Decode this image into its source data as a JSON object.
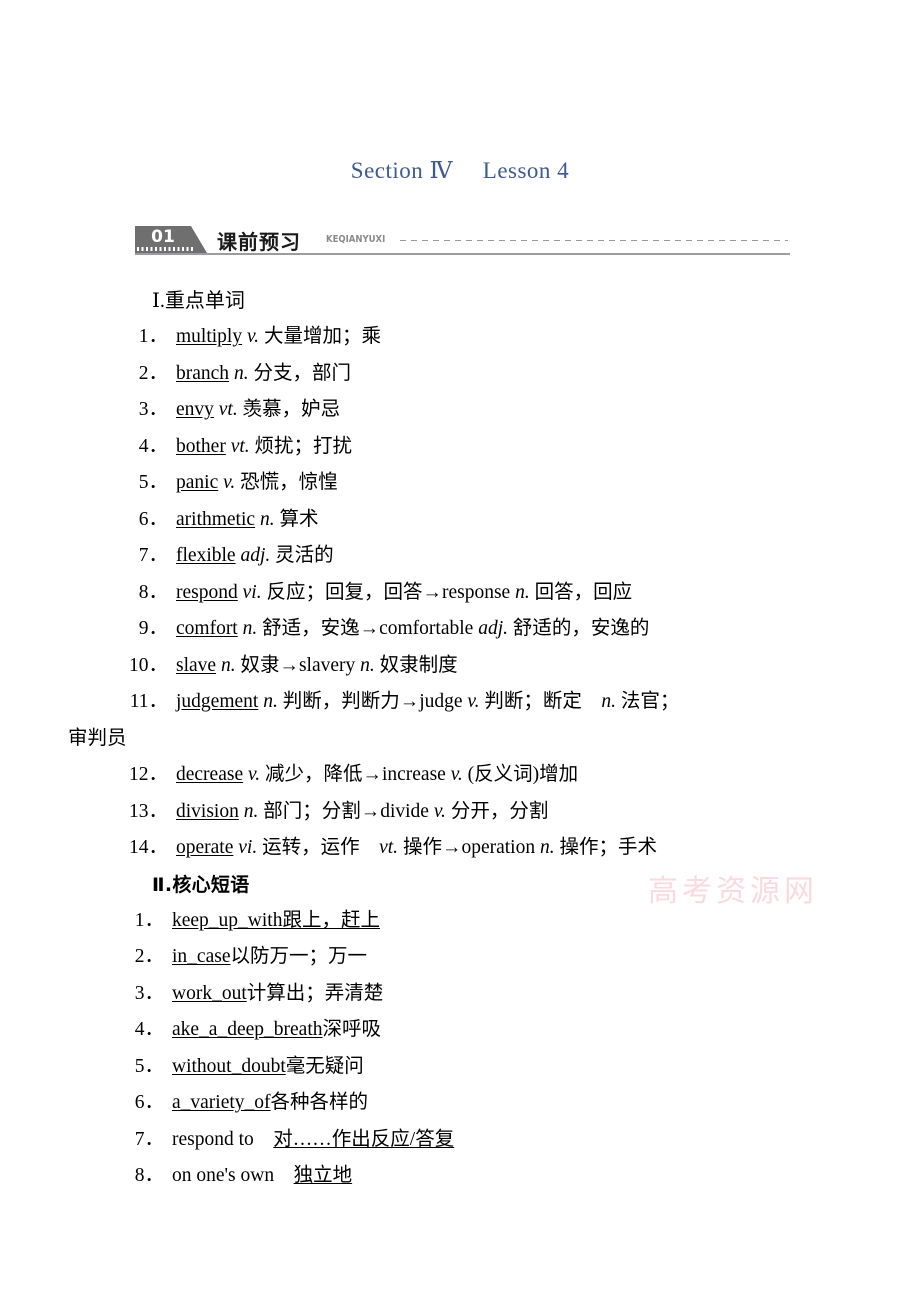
{
  "title": "Section Ⅳ  Lesson 4",
  "banner": {
    "number": "01",
    "label": "课前预习",
    "pinyin": "KEQIANYUXI"
  },
  "watermark": "高考资源网",
  "part1": {
    "heading": "Ⅰ.重点单词",
    "items": [
      {
        "num": "1．",
        "word": "multiply",
        "pos": "v.",
        "rest": " 大量增加；乘"
      },
      {
        "num": "2．",
        "word": "branch",
        "pos": "n.",
        "rest": " 分支，部门"
      },
      {
        "num": "3．",
        "word": "envy",
        "pos": "vt.",
        "rest": " 羡慕，妒忌"
      },
      {
        "num": "4．",
        "word": "bother",
        "pos": "vt.",
        "rest": " 烦扰；打扰"
      },
      {
        "num": "5．",
        "word": "panic",
        "pos": "v.",
        "rest": " 恐慌，惊惶"
      },
      {
        "num": "6．",
        "word": "arithmetic",
        "pos": "n.",
        "rest": " 算术"
      },
      {
        "num": "7．",
        "word": "flexible",
        "pos": "adj.",
        "rest": " 灵活的"
      },
      {
        "num": "8．",
        "word": "respond",
        "pos": "vi.",
        "rest": " 反应；回复，回答→response ",
        "pos2": "n.",
        "rest2": " 回答，回应"
      },
      {
        "num": "9．",
        "word": "comfort",
        "pos": "n.",
        "rest": " 舒适，安逸→comfortable ",
        "pos2": "adj.",
        "rest2": " 舒适的，安逸的"
      },
      {
        "num": "10．",
        "word": "slave",
        "pos": "n.",
        "rest": " 奴隶→slavery ",
        "pos2": "n.",
        "rest2": " 奴隶制度"
      },
      {
        "num": "11．",
        "word": "judgement",
        "pos": "n.",
        "rest": " 判断，判断力→judge ",
        "pos2": "v.",
        "rest2": " 判断；断定 ",
        "pos3": "n.",
        "rest3": " 法官；审判员"
      },
      {
        "num": "12．",
        "word": "decrease",
        "pos": "v.",
        "rest": " 减少，降低→increase ",
        "pos2": "v.",
        "rest2": " (反义词)增加"
      },
      {
        "num": "13．",
        "word": "division",
        "pos": "n.",
        "rest": " 部门；分割→divide ",
        "pos2": "v.",
        "rest2": " 分开，分割"
      },
      {
        "num": "14．",
        "word": "operate",
        "pos": "vi.",
        "rest": " 运转，运作 ",
        "pos2": "vt.",
        "rest2": " 操作→operation ",
        "pos3": "n.",
        "rest3": " 操作；手术"
      }
    ]
  },
  "part2": {
    "heading": "Ⅱ.核心短语",
    "items": [
      {
        "num": "1．",
        "phrase": "keep_up_with",
        "meaning": "跟上，赶上",
        "underline": "both"
      },
      {
        "num": "2．",
        "phrase": "in_case",
        "meaning": "以防万一；万一",
        "underline": "phrase"
      },
      {
        "num": "3．",
        "phrase": "work_out",
        "meaning": "计算出；弄清楚",
        "underline": "phrase"
      },
      {
        "num": "4．",
        "phrase": "ake_a_deep_breath",
        "meaning": "深呼吸",
        "underline": "phrase"
      },
      {
        "num": "5．",
        "phrase": "without_doubt",
        "meaning": "毫无疑问",
        "underline": "phrase"
      },
      {
        "num": "6．",
        "phrase": "a_variety_of",
        "meaning": "各种各样的",
        "underline": "phrase"
      },
      {
        "num": "7．",
        "phrase": "respond to",
        "meaning": "对……作出反应/答复",
        "underline": "meaning"
      },
      {
        "num": "8．",
        "phrase": "on one's own",
        "meaning": "独立地",
        "underline": "meaning"
      }
    ]
  }
}
